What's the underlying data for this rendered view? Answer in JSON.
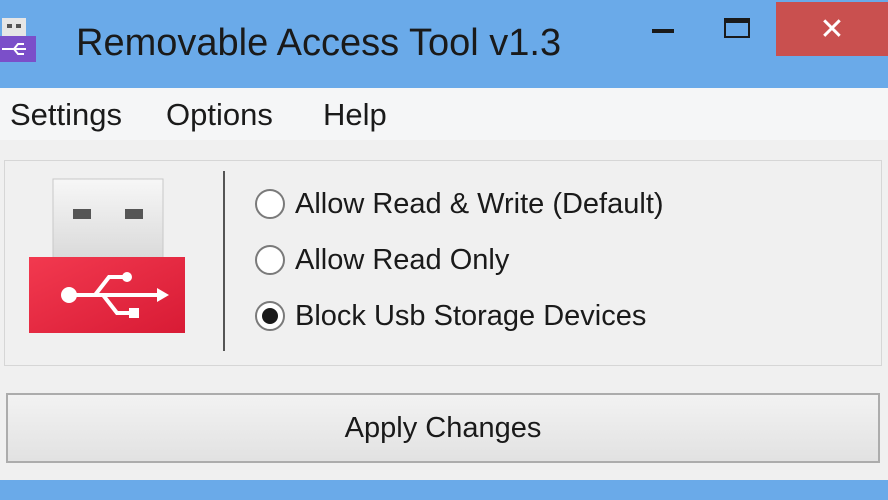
{
  "window": {
    "title": "Removable Access Tool v1.3",
    "close_glyph": "✕"
  },
  "menu": {
    "items": [
      {
        "label": "Settings"
      },
      {
        "label": "Options"
      },
      {
        "label": "Help"
      }
    ]
  },
  "options": [
    {
      "label": "Allow Read & Write (Default)",
      "selected": false
    },
    {
      "label": "Allow Read Only",
      "selected": false
    },
    {
      "label": "Block Usb Storage Devices",
      "selected": true
    }
  ],
  "actions": {
    "apply_label": "Apply Changes"
  },
  "icons": [
    "app-usb-icon",
    "minimize-icon",
    "maximize-icon",
    "close-icon",
    "usb-drive-icon"
  ],
  "colors": {
    "titlebar": "#6aaae9",
    "close_button": "#c9504f",
    "usb_red": "#e8233f"
  }
}
